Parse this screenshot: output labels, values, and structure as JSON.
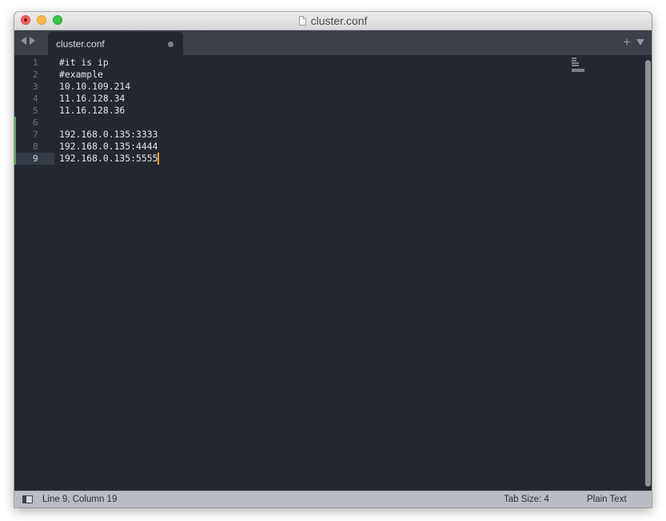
{
  "window": {
    "title": "cluster.conf"
  },
  "tabs": [
    {
      "label": "cluster.conf",
      "dirty": true
    }
  ],
  "editor": {
    "active_line": 9,
    "lines": [
      {
        "num": "1",
        "text": "#it is ip"
      },
      {
        "num": "2",
        "text": "#example"
      },
      {
        "num": "3",
        "text": "10.10.109.214"
      },
      {
        "num": "4",
        "text": "11.16.128.34"
      },
      {
        "num": "5",
        "text": "11.16.128.36"
      },
      {
        "num": "6",
        "text": ""
      },
      {
        "num": "7",
        "text": "192.168.0.135:3333"
      },
      {
        "num": "8",
        "text": "192.168.0.135:4444"
      },
      {
        "num": "9",
        "text": "192.168.0.135:5555"
      }
    ],
    "modified_lines": [
      6,
      7,
      8,
      9
    ]
  },
  "statusbar": {
    "position": "Line 9, Column 19",
    "tab_size": "Tab Size: 4",
    "syntax": "Plain Text"
  },
  "colors": {
    "editor_bg": "#232830",
    "cursor": "#f5a623",
    "diff_added": "#5fa35c"
  },
  "icons": {
    "close": "close-icon",
    "minimize": "minimize-icon",
    "maximize": "maximize-icon",
    "file": "file-icon",
    "nav_back": "arrow-left-icon",
    "nav_forward": "arrow-right-icon",
    "new_tab": "plus-icon",
    "tabs_menu": "chevron-down-icon",
    "sidebar_toggle": "sidebar-toggle-icon"
  }
}
